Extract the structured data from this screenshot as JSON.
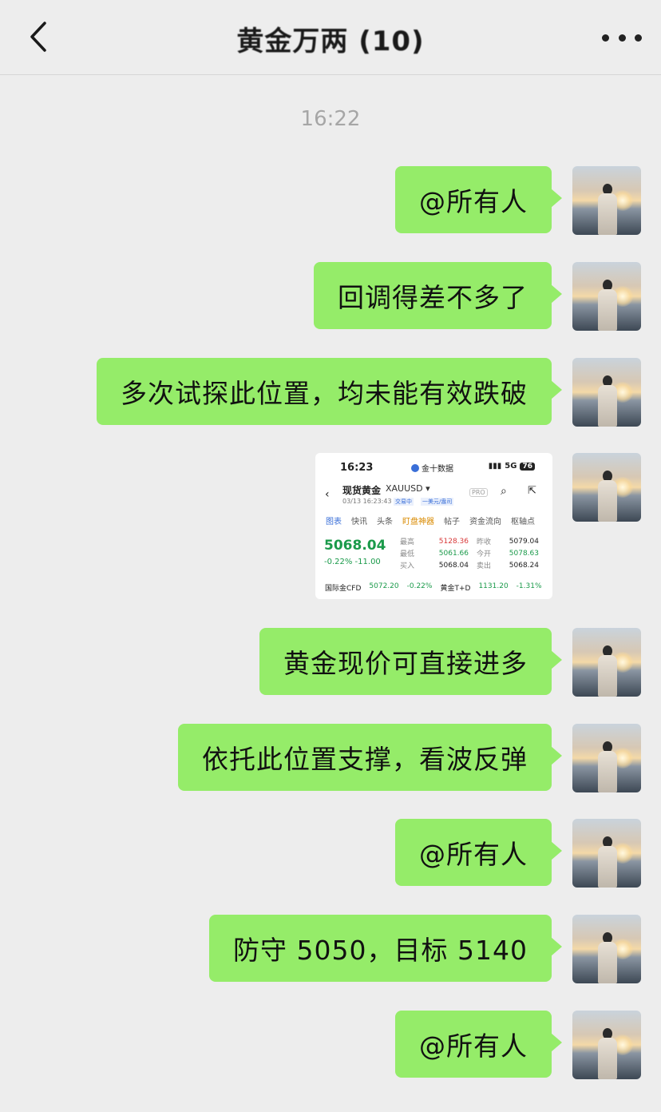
{
  "header": {
    "title": "黄金万两 (10)",
    "back_icon": "chevron-left-icon",
    "more_icon": "more-dots-icon"
  },
  "timestamp": "16:22",
  "messages": [
    {
      "text": "@所有人"
    },
    {
      "text": "回调得差不多了"
    },
    {
      "text": "多次试探此位置，均未能有效跌破"
    },
    {
      "text": "黄金现价可直接进多"
    },
    {
      "text": "依托此位置支撑，看波反弹"
    },
    {
      "text": "@所有人"
    },
    {
      "text": "防守 5050，目标 5140"
    },
    {
      "text": "@所有人"
    }
  ],
  "shot": {
    "status_time": "16:23",
    "app_name": "金十数据",
    "signal": "5G",
    "battery": "76",
    "name": "现货黄金",
    "code": "XAUUSD ▾",
    "date": "03/13 16:23:43",
    "tag1": "交易中",
    "tag2": "一美元/盎司",
    "pro": "PRO",
    "tabs": [
      "图表",
      "快讯",
      "头条",
      "盯盘神器",
      "帖子",
      "资金流向",
      "枢轴点"
    ],
    "price": "5068.04",
    "change": "-0.22%  -11.00",
    "grid": [
      {
        "l1": "最高",
        "v1": "5128.36",
        "l2": "昨收",
        "v2": "5079.04"
      },
      {
        "l1": "最低",
        "v1": "5061.66",
        "l2": "今开",
        "v2": "5078.63"
      },
      {
        "l1": "买入",
        "v1": "5068.04",
        "l2": "卖出",
        "v2": "5068.24"
      }
    ],
    "foot": {
      "l1": "国际金CFD",
      "v1": "5072.20",
      "c1": "-0.22%",
      "l2": "黄金T+D",
      "v2": "1131.20",
      "c2": "-1.31%"
    }
  },
  "colors": {
    "bubble": "#95ec69",
    "background": "#ededed",
    "up": "#d83a3a",
    "down": "#1a9a4a"
  }
}
